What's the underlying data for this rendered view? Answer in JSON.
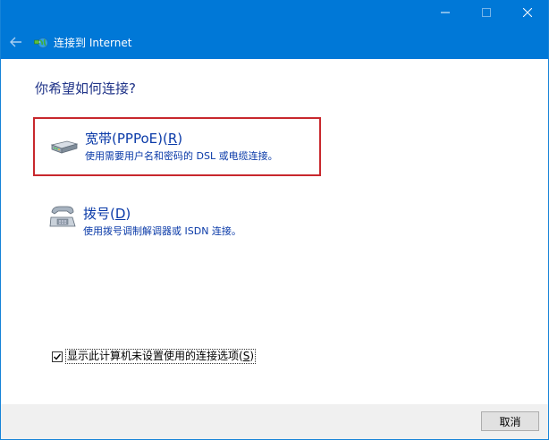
{
  "window": {
    "title": "连接到 Internet",
    "controls": {
      "minimize": "—",
      "maximize": "☐",
      "close": "✕"
    }
  },
  "main": {
    "question": "你希望如何连接?",
    "options": [
      {
        "title": "宽带(PPPoE)(",
        "mnemonic": "R",
        "title_end": ")",
        "description": "使用需要用户名和密码的 DSL 或电缆连接。",
        "icon": "broadband-modem-icon",
        "selected": true
      },
      {
        "title": "拨号(",
        "mnemonic": "D",
        "title_end": ")",
        "description": "使用拨号调制解调器或 ISDN 连接。",
        "icon": "telephone-modem-icon",
        "selected": false
      }
    ],
    "checkbox": {
      "label": "显示此计算机未设置使用的连接选项(",
      "mnemonic": "S",
      "label_end": ")",
      "checked": true
    }
  },
  "footer": {
    "cancel_label": "取消"
  },
  "colors": {
    "titlebar": "#0078d7",
    "link_text": "#0a3aa8",
    "heading_text": "#1e3287",
    "selection_border": "#c8282d",
    "footer_bg": "#f0f0f0"
  }
}
